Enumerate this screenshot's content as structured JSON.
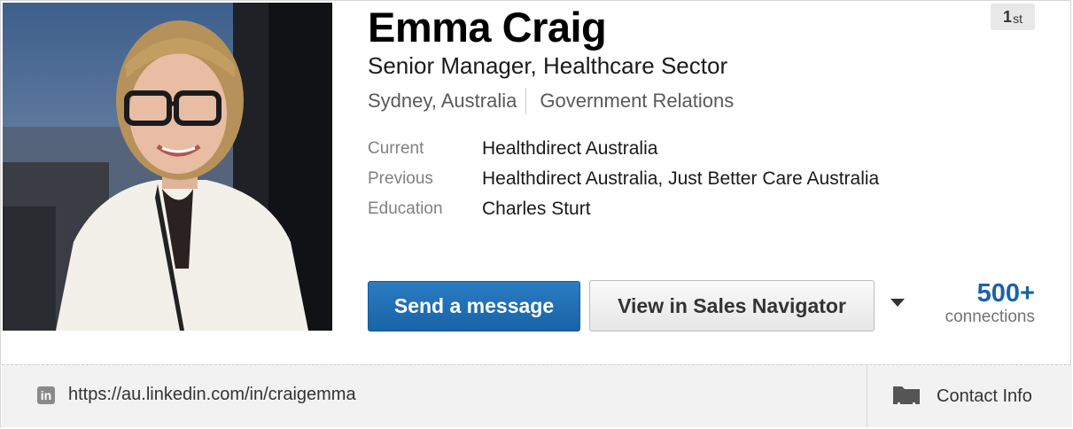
{
  "profile": {
    "name": "Emma Craig",
    "headline": "Senior Manager, Healthcare Sector",
    "location": "Sydney, Australia",
    "industry": "Government Relations",
    "degree": "1",
    "degree_suffix": "st",
    "current_label": "Current",
    "current_value": "Healthdirect Australia",
    "previous_label": "Previous",
    "previous_value": "Healthdirect Australia, Just Better Care Australia",
    "education_label": "Education",
    "education_value": "Charles Sturt"
  },
  "actions": {
    "send_message": "Send a message",
    "sales_navigator": "View in Sales Navigator",
    "more_icon": "chevron-down-icon"
  },
  "connections": {
    "count": "500+",
    "label": "connections"
  },
  "footer": {
    "profile_url": "https://au.linkedin.com/in/craigemma",
    "linkedin_icon": "linkedin-icon",
    "contact_label": "Contact Info",
    "contact_icon": "contact-card-icon"
  },
  "colors": {
    "primary_button": "#1a63a8",
    "connections_count": "#1a63a8",
    "footer_bg": "#f2f2f2"
  }
}
